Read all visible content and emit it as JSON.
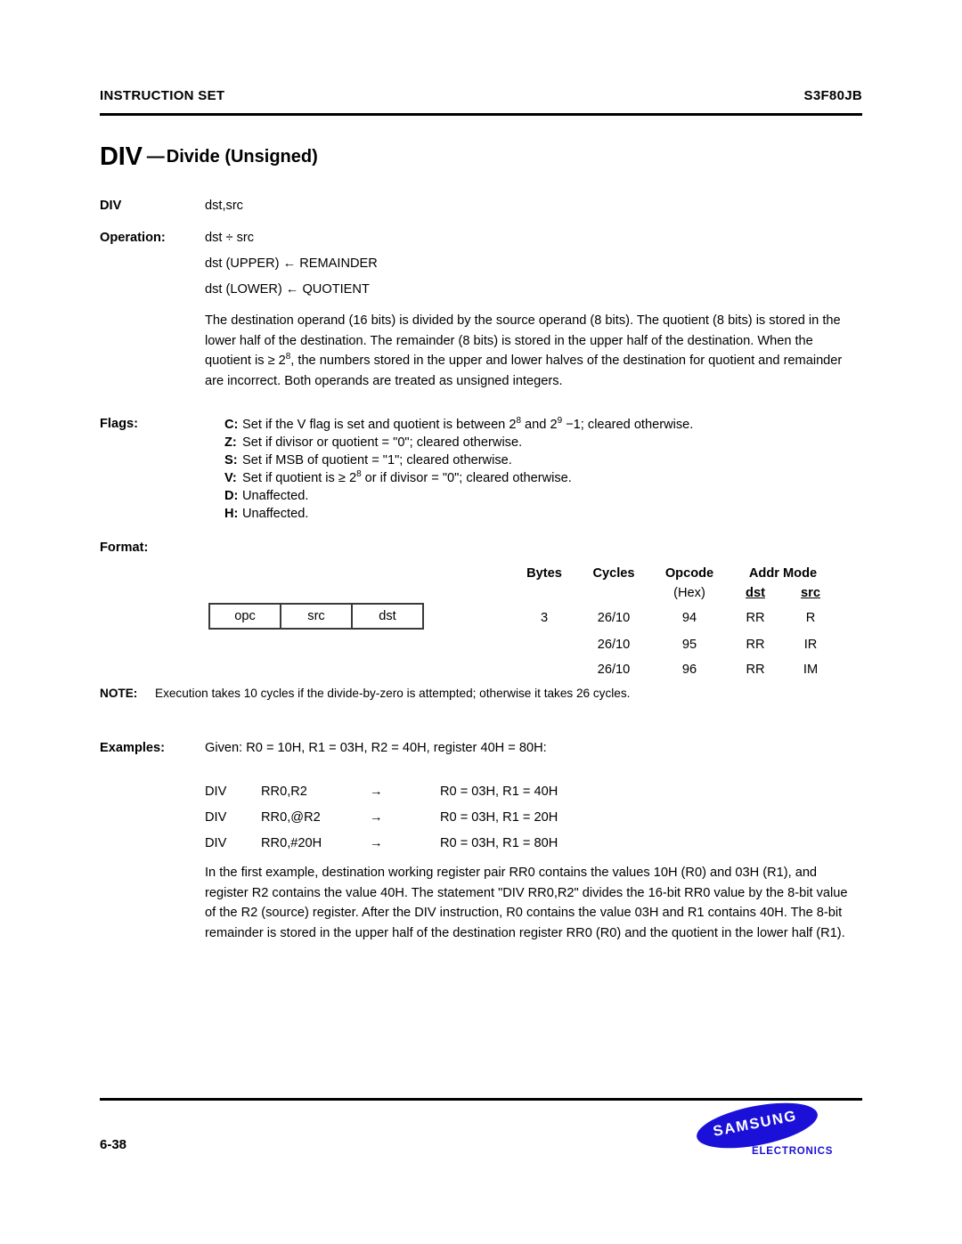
{
  "header": {
    "left": "INSTRUCTION SET",
    "right": "S3F80JB"
  },
  "title": {
    "mnemonic": "DIV",
    "dash": "—",
    "subject": "Divide (Unsigned)"
  },
  "syntax": {
    "label": "DIV",
    "operands": "dst,src"
  },
  "operation": {
    "label": "Operation:",
    "line1": "dst ÷ src",
    "line2": "dst (UPPER) ← REMAINDER",
    "line3": "dst (LOWER) ← QUOTIENT"
  },
  "description": {
    "part1": "The destination operand (16 bits) is divided by the source operand (8 bits). The quotient (8 bits) is stored in the lower half of the destination. The remainder (8 bits) is stored in the upper half of the destination. When the quotient is ≥ 2",
    "sup1": "8",
    "part2": ", the numbers stored in the upper and lower halves of the destination for quotient and remainder are incorrect. Both operands are treated as unsigned integers."
  },
  "flags": {
    "label": "Flags:",
    "items": [
      {
        "key": "C:",
        "pre": "Set if the V flag is set and quotient is between 2",
        "sup1": "8",
        "mid": " and 2",
        "sup2": "9",
        "post": " −1; cleared otherwise."
      },
      {
        "key": "Z:",
        "pre": "Set if divisor or quotient  =  \"0\"; cleared otherwise.",
        "sup1": "",
        "mid": "",
        "sup2": "",
        "post": ""
      },
      {
        "key": "S:",
        "pre": "Set if MSB of quotient  =  \"1\"; cleared otherwise.",
        "sup1": "",
        "mid": "",
        "sup2": "",
        "post": ""
      },
      {
        "key": "V:",
        "pre": "Set if quotient is  ≥  2",
        "sup1": "8",
        "mid": "",
        "sup2": "",
        "post": " or if divisor  =  \"0\"; cleared otherwise."
      },
      {
        "key": "D:",
        "pre": "Unaffected.",
        "sup1": "",
        "mid": "",
        "sup2": "",
        "post": ""
      },
      {
        "key": "H:",
        "pre": "Unaffected.",
        "sup1": "",
        "mid": "",
        "sup2": "",
        "post": ""
      }
    ]
  },
  "format": {
    "label": "Format:",
    "opcode_box": [
      "opc",
      "src",
      "dst"
    ],
    "table": {
      "headers": {
        "bytes": "Bytes",
        "cycles": "Cycles",
        "opcode": "Opcode",
        "opcode_sub": "(Hex)",
        "addr_mode": "Addr Mode",
        "dst": "dst",
        "src": "src"
      },
      "rows": [
        {
          "bytes": "3",
          "cycles": "26/10",
          "opcode": "94",
          "dst": "RR",
          "src": "R"
        },
        {
          "bytes": "",
          "cycles": "26/10",
          "opcode": "95",
          "dst": "RR",
          "src": "IR"
        },
        {
          "bytes": "",
          "cycles": "26/10",
          "opcode": "96",
          "dst": "RR",
          "src": "IM"
        }
      ]
    }
  },
  "note": {
    "label": "NOTE:",
    "text": "Execution takes 10 cycles if the divide-by-zero is attempted; otherwise it takes 26 cycles."
  },
  "examples": {
    "label": "Examples:",
    "given": "Given:  R0  =  10H, R1  =  03H, R2  =  40H, register 40H  =  80H:",
    "lines": [
      {
        "op": "DIV",
        "args": "RR0,R2",
        "arrow": "→",
        "result": "R0  =  03H, R1  =  40H"
      },
      {
        "op": "DIV",
        "args": "RR0,@R2",
        "arrow": "→",
        "result": "R0  =  03H, R1  =  20H"
      },
      {
        "op": "DIV",
        "args": "RR0,#20H",
        "arrow": "→",
        "result": "R0  =  03H, R1  =  80H"
      }
    ]
  },
  "final_paragraph": "In the first example, destination working register pair RR0 contains the values 10H (R0) and 03H (R1), and register R2 contains the value 40H. The statement \"DIV  RR0,R2\" divides the 16-bit RR0 value by the 8-bit value of the R2 (source) register. After the DIV instruction, R0 contains the value 03H and R1 contains 40H. The 8-bit remainder is stored in the upper half of the destination register RR0 (R0) and the quotient in the lower half (R1).",
  "footer": {
    "page_number": "6-38",
    "logo_wordmark": "SAMSUNG",
    "logo_subtext": "ELECTRONICS",
    "brand_color": "#1a10d8"
  }
}
